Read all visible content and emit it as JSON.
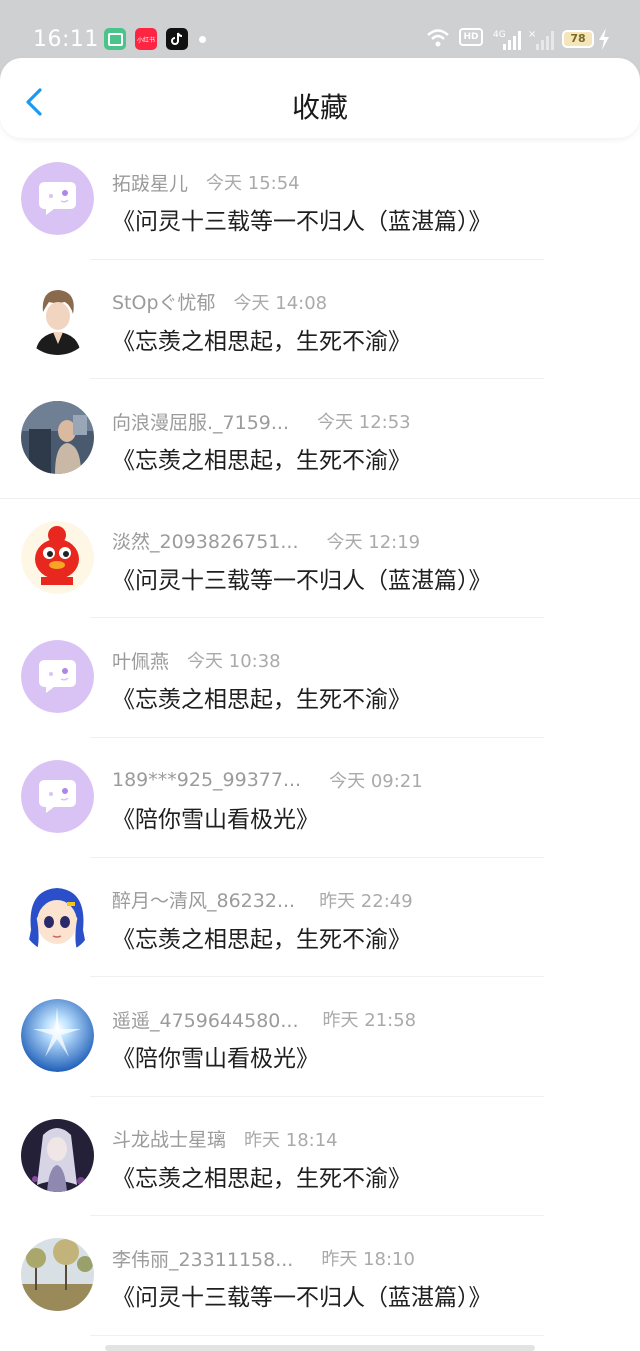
{
  "status_bar": {
    "time": "16:11",
    "hd_label": "HD",
    "network_label": "4G",
    "battery_level": "78",
    "app_icons": [
      "app-icon",
      "xiaohongshu-icon",
      "douyin-icon"
    ],
    "app2_label": "小红书"
  },
  "header": {
    "title": "收藏",
    "back_icon": "chevron-left-icon"
  },
  "colors": {
    "accent": "#1a9bf0",
    "placeholder_avatar": "#d9c3f5"
  },
  "items": [
    {
      "name": "拓跋星儿",
      "time": "今天 15:54",
      "title": "《问灵十三载等一不归人（蓝湛篇）》",
      "avatar": "placeholder"
    },
    {
      "name": "StOpぐ忧郁",
      "time": "今天 14:08",
      "title": "《忘羡之相思起，生死不渝》",
      "avatar": "boy"
    },
    {
      "name": "向浪漫屈服._7159...",
      "time": "今天 12:53",
      "title": "《忘羡之相思起，生死不渝》",
      "avatar": "photo"
    },
    {
      "name": "淡然_2093826751...",
      "time": "今天 12:19",
      "title": "《问灵十三载等一不归人（蓝湛篇）》",
      "avatar": "red-mascot"
    },
    {
      "name": "叶佩燕",
      "time": "今天 10:38",
      "title": "《忘羡之相思起，生死不渝》",
      "avatar": "placeholder"
    },
    {
      "name": "189***925_99377...",
      "time": "今天 09:21",
      "title": "《陪你雪山看极光》",
      "avatar": "placeholder"
    },
    {
      "name": "醉月～清风_86232...",
      "time": "昨天 22:49",
      "title": "《忘羡之相思起，生死不渝》",
      "avatar": "anime-girl"
    },
    {
      "name": "遥遥_4759644580...",
      "time": "昨天 21:58",
      "title": "《陪你雪山看极光》",
      "avatar": "sky"
    },
    {
      "name": "斗龙战士星璃",
      "time": "昨天 18:14",
      "title": "《忘羡之相思起，生死不渝》",
      "avatar": "dark-fantasy"
    },
    {
      "name": "李伟丽_23311158...",
      "time": "昨天 18:10",
      "title": "《问灵十三载等一不归人（蓝湛篇）》",
      "avatar": "trees"
    }
  ]
}
